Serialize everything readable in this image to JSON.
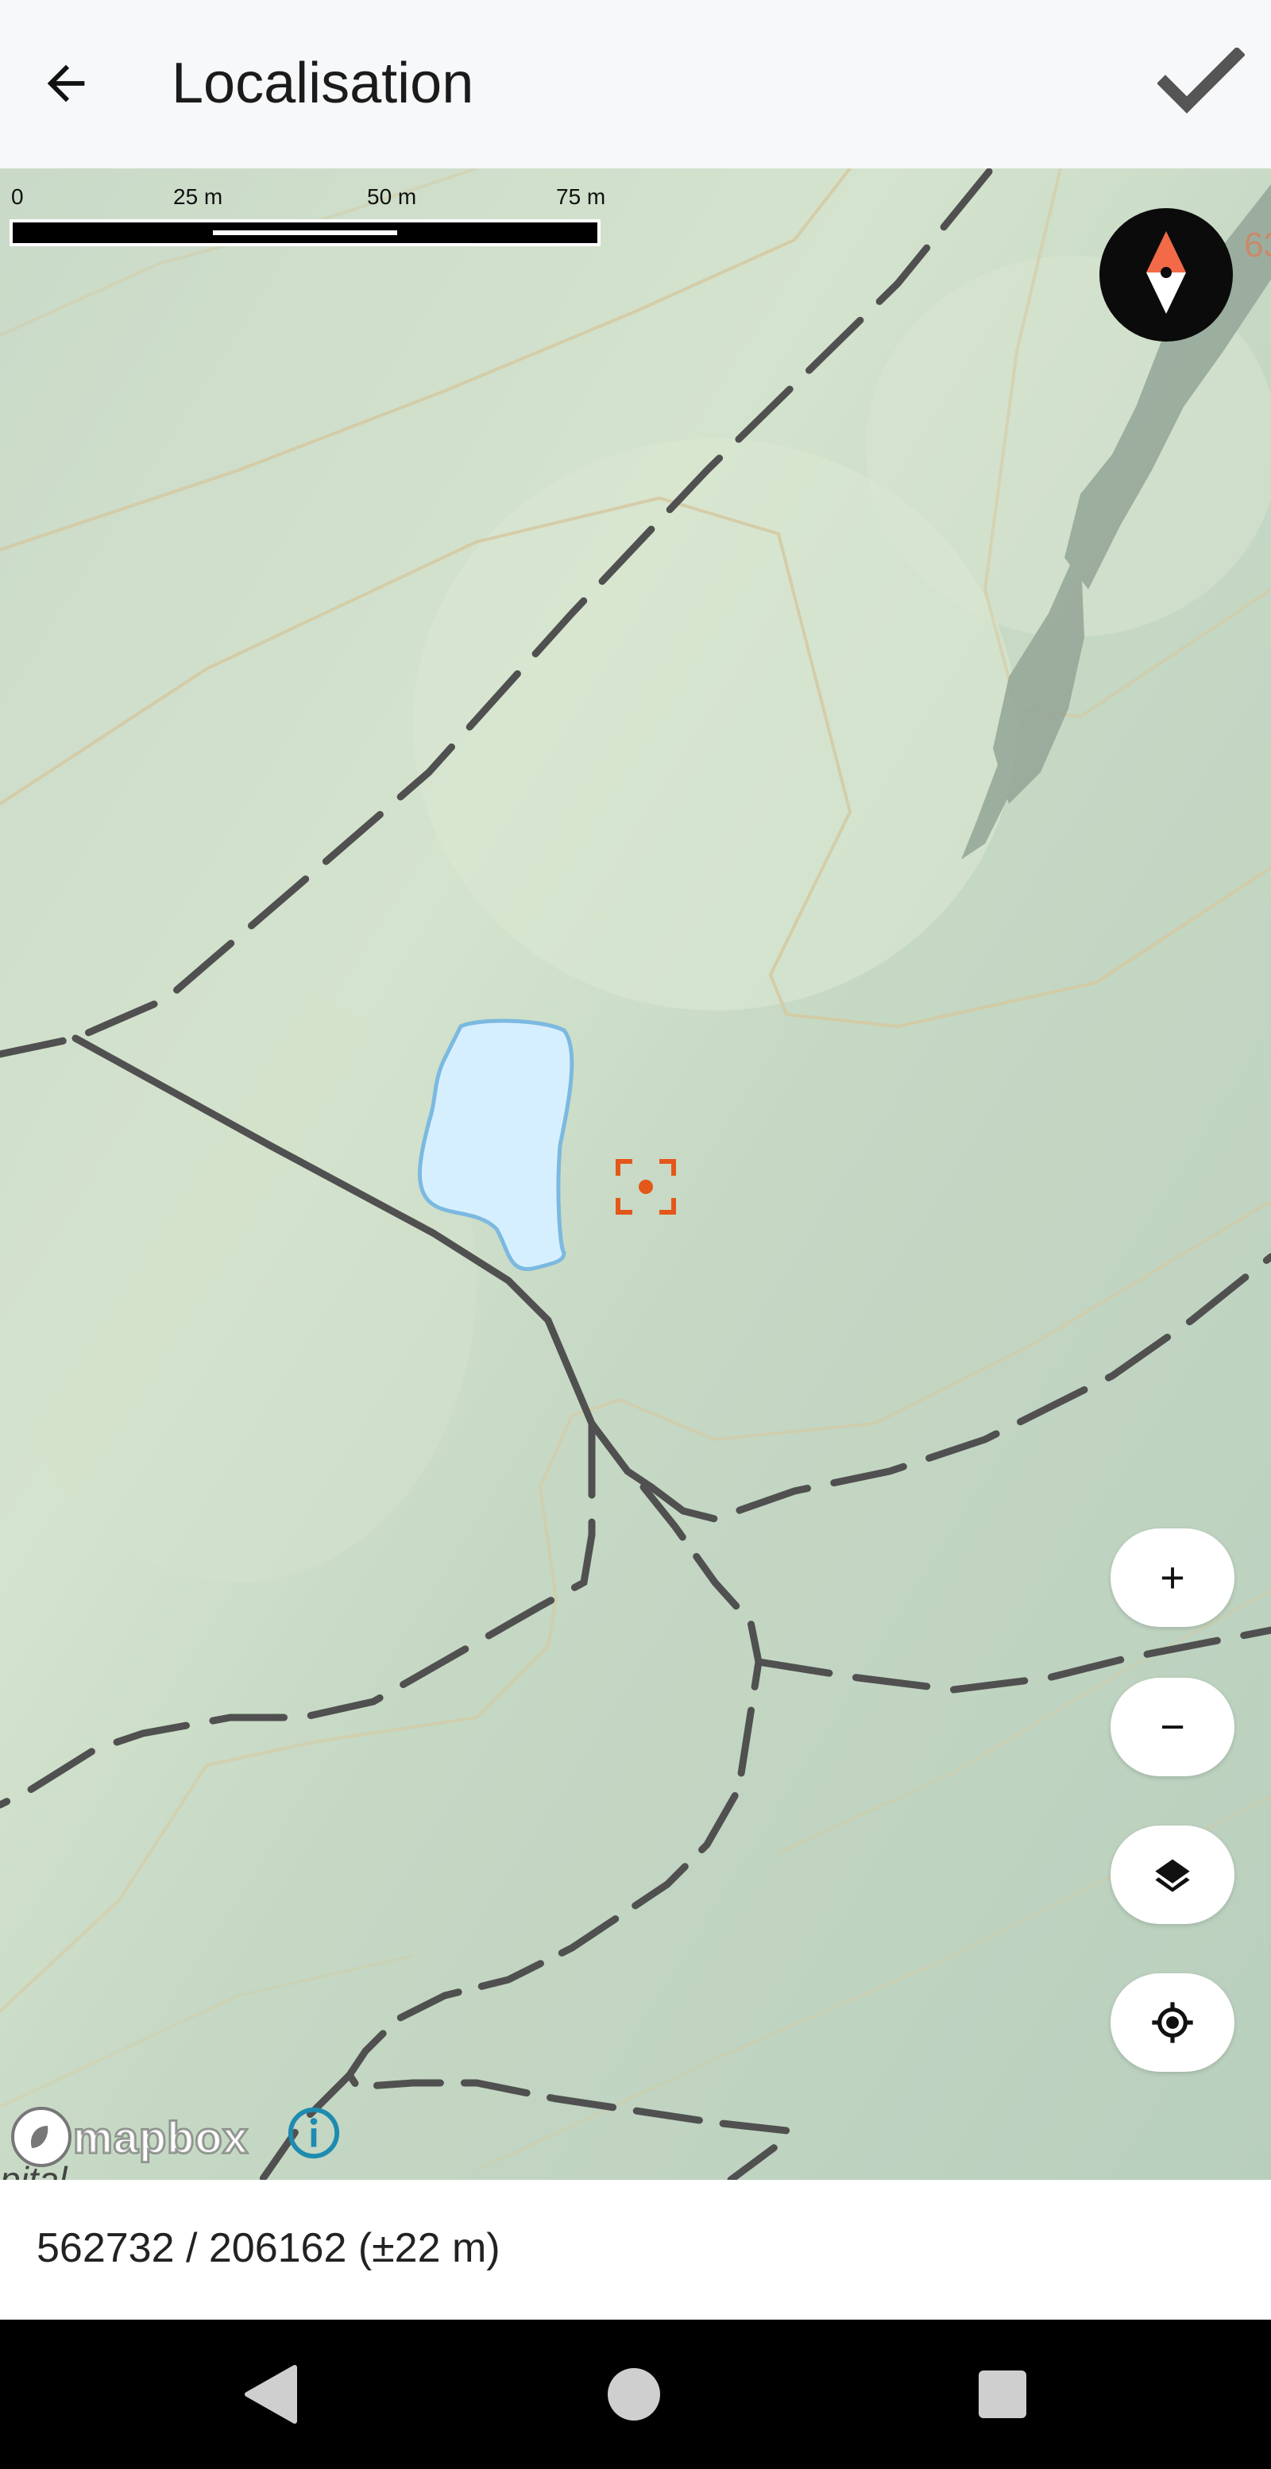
{
  "header": {
    "title": "Localisation",
    "back_icon": "arrow-left-icon",
    "confirm_icon": "check-icon"
  },
  "map": {
    "scale": {
      "labels": [
        "0",
        "25 m",
        "50 m",
        "75 m"
      ]
    },
    "compass_icon": "compass-icon",
    "controls": {
      "zoom_in": "+",
      "zoom_out": "−",
      "layers_icon": "layers-icon",
      "locate_icon": "crosshair-icon"
    },
    "attribution": {
      "brand": "mapbox",
      "info_icon": "info-icon"
    },
    "partial_label": "pital",
    "edge_label": "63",
    "marker_icon": "location-target-icon"
  },
  "coordinates": {
    "text": "562732 / 206162 (±22 m)"
  },
  "colors": {
    "accent": "#e4571a",
    "water": "#d6efff",
    "water_border": "#7cb9e0",
    "map_bg": "#c6d9c5",
    "contour": "#d3c9a0",
    "path": "#505050"
  },
  "navbar": {
    "back_icon": "nav-back-icon",
    "home_icon": "nav-home-icon",
    "recents_icon": "nav-recents-icon"
  }
}
